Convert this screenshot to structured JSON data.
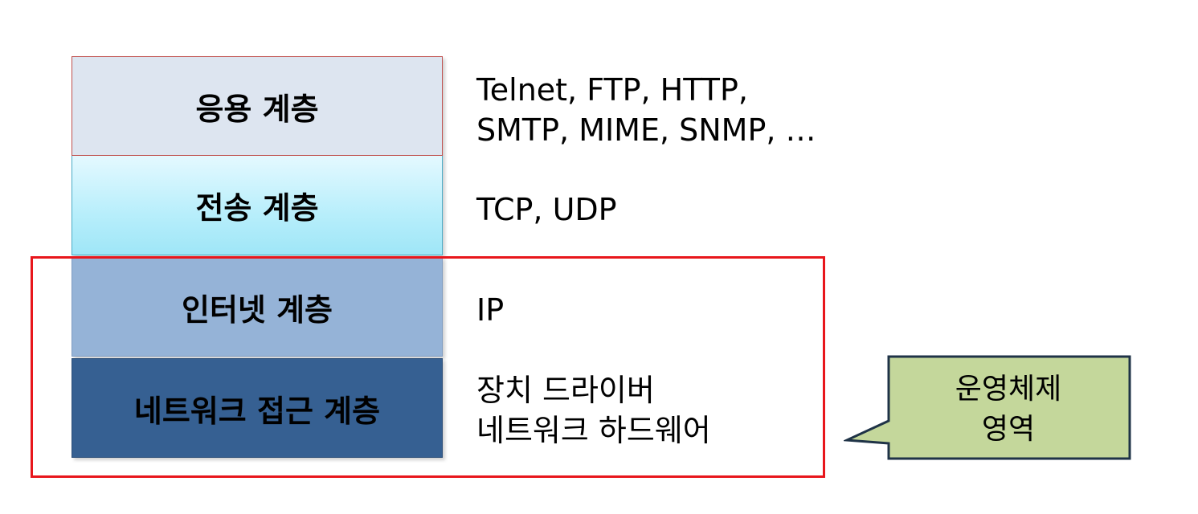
{
  "layers": [
    {
      "label": "응용 계층"
    },
    {
      "label": "전송 계층"
    },
    {
      "label": "인터넷 계층"
    },
    {
      "label": "네트워크 접근 계층"
    }
  ],
  "protocols": {
    "application": [
      "Telnet, FTP, HTTP,",
      "SMTP, MIME, SNMP, …"
    ],
    "transport": [
      "TCP, UDP"
    ],
    "internet": [
      "IP"
    ],
    "network_access": [
      "장치 드라이버",
      "네트워크 하드웨어"
    ]
  },
  "callout": {
    "lines": [
      "운영체제",
      "영역"
    ]
  },
  "colors": {
    "application_fill": "#dde5f0",
    "transport_fill": "#b7eefb",
    "internet_fill": "#95b3d7",
    "network_access_fill": "#366092",
    "os_frame": "#e8161c",
    "callout_fill": "#c4d79b",
    "callout_border": "#1f3347"
  }
}
